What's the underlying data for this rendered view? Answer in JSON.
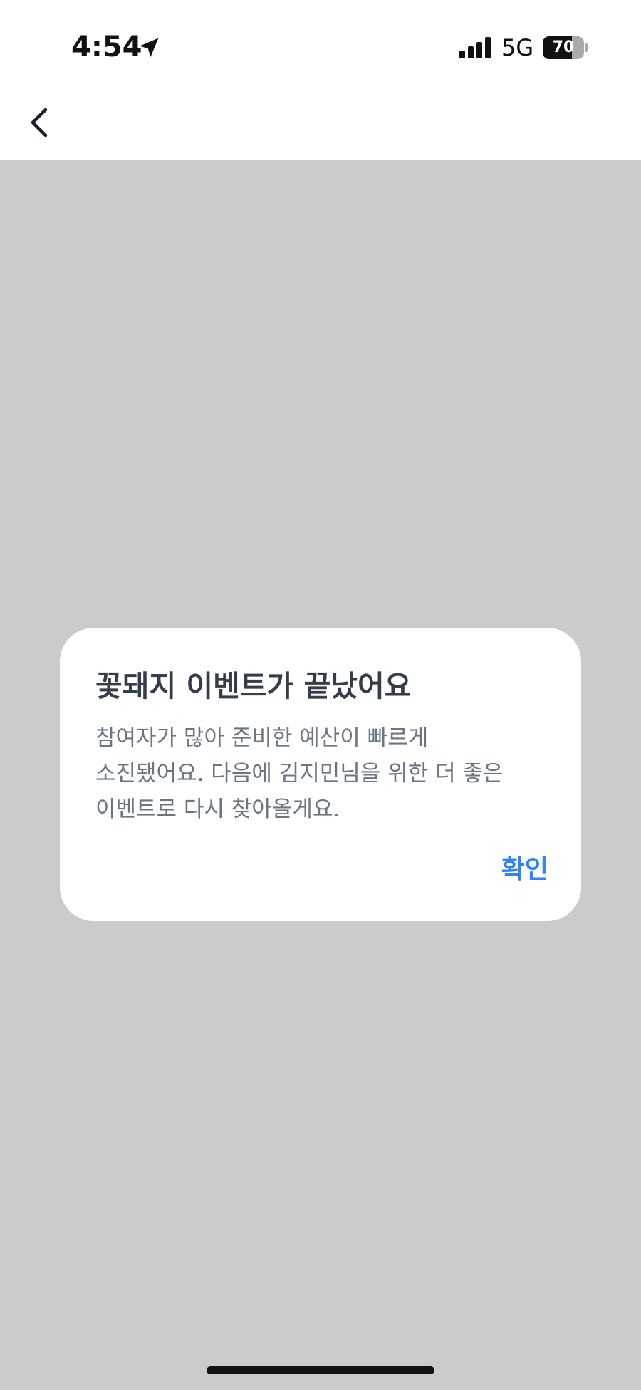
{
  "status_bar": {
    "time": "4:54",
    "location_icon": "location-arrow-icon",
    "signal_icon": "cellular-signal-icon",
    "network": "5G",
    "battery_level": "70",
    "battery_fraction": 0.7
  },
  "nav": {
    "back_icon": "chevron-left-icon"
  },
  "dialog": {
    "title": "꽃돼지 이벤트가 끝났어요",
    "message_lines": [
      "참여자가 많아 준비한 예산이 빠르게",
      "소진됐어요. 다음에 김지민님을 위한 더 좋은",
      "이벤트로 다시 찾아올게요."
    ],
    "confirm_label": "확인"
  },
  "colors": {
    "overlay": "#cbcbcb",
    "title": "#333d4b",
    "message": "#6b7684",
    "accent": "#3182f6"
  }
}
